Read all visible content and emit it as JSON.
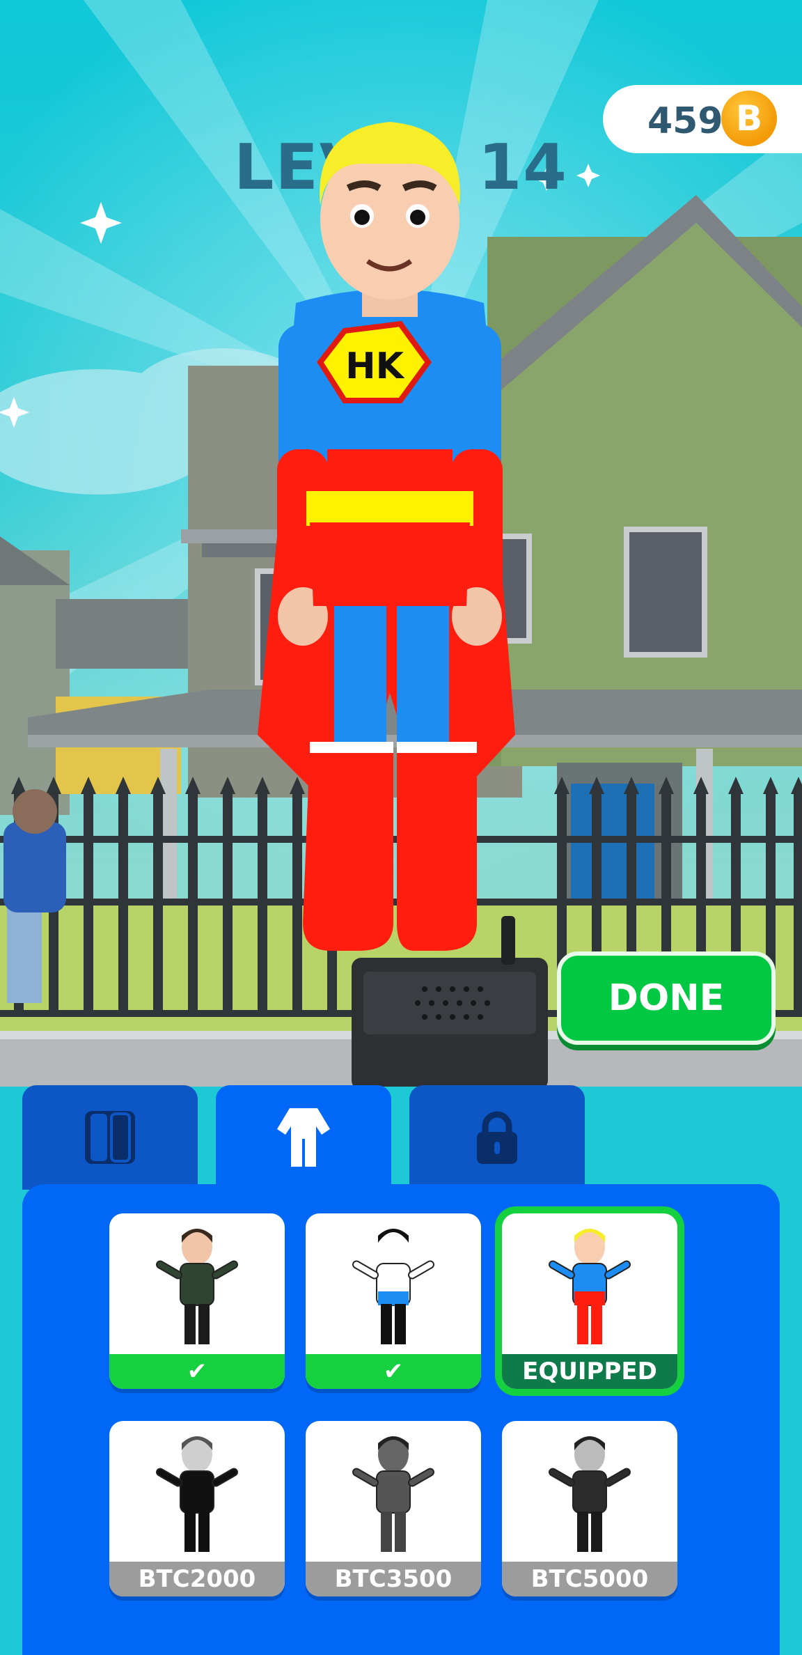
{
  "hud": {
    "coins": "459",
    "coin_symbol": "B",
    "level_text": "LEVEL 14"
  },
  "hero": {
    "emblem": "HK"
  },
  "actions": {
    "done_label": "DONE"
  },
  "tabs": [
    {
      "icon": "phone-case-icon",
      "active": false
    },
    {
      "icon": "outfit-icon",
      "active": true
    },
    {
      "icon": "lock-icon",
      "active": false
    }
  ],
  "skins": [
    {
      "name": "hoodie-guy",
      "footer": "✔",
      "status": "owned"
    },
    {
      "name": "panda",
      "footer": "✔",
      "status": "owned"
    },
    {
      "name": "superhero",
      "footer": "EQUIPPED",
      "status": "equipped"
    },
    {
      "name": "suit",
      "footer": "BTC2000",
      "status": "price"
    },
    {
      "name": "armor",
      "footer": "BTC3500",
      "status": "price"
    },
    {
      "name": "trench-coat",
      "footer": "BTC5000",
      "status": "price"
    }
  ],
  "colors": {
    "sky": "#10c8d8",
    "panel": "#0067f6",
    "tab_inactive": "#0c57c5",
    "owned_green": "#16d13f",
    "equipped_green": "#0f7a4a",
    "price_gray": "#9c9c9c"
  }
}
